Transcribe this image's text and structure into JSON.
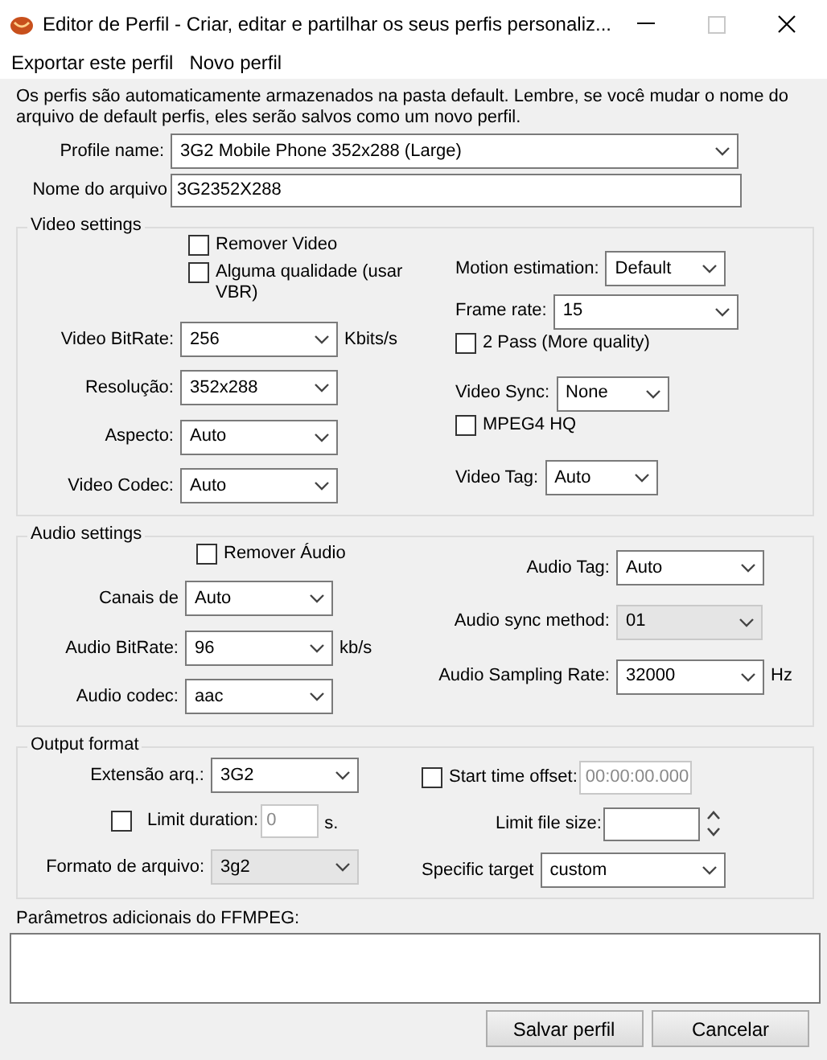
{
  "window": {
    "title": "Editor de Perfil - Criar, editar e partilhar os seus perfis personaliz..."
  },
  "menu": [
    "Exportar este perfil",
    "Novo perfil"
  ],
  "info": "Os perfis são automaticamente armazenados na pasta default. Lembre, se você mudar o nome do arquivo de default perfis, eles serão salvos como um novo perfil.",
  "profile_name": {
    "label": "Profile name:",
    "value": "3G2 Mobile Phone 352x288 (Large)"
  },
  "file_name": {
    "label": "Nome do arquivo",
    "value": "3G2352X288"
  },
  "sections": [
    {
      "title": "Video settings",
      "left": [
        {
          "kind": "checkbox",
          "label": "Remover Video",
          "checked": false
        },
        {
          "kind": "checkbox",
          "label": "Alguma qualidade (usar VBR)",
          "checked": false
        },
        {
          "kind": "select",
          "label": "Video BitRate:",
          "value": "256",
          "unit": "Kbits/s",
          "disabled": false
        },
        {
          "kind": "select",
          "label": "Resolução:",
          "value": "352x288",
          "disabled": false
        },
        {
          "kind": "select",
          "label": "Aspecto:",
          "value": "Auto",
          "disabled": false
        },
        {
          "kind": "select",
          "label": "Video Codec:",
          "value": "Auto",
          "disabled": false
        }
      ],
      "right": [
        {
          "kind": "select",
          "label": "Motion estimation:",
          "value": "Default",
          "disabled": false
        },
        {
          "kind": "select",
          "label": "Frame rate:",
          "value": "15",
          "disabled": false
        },
        {
          "kind": "checkbox",
          "label": "2 Pass (More quality)",
          "checked": false
        },
        {
          "kind": "select",
          "label": "Video Sync:",
          "value": "None",
          "disabled": false
        },
        {
          "kind": "checkbox",
          "label": "MPEG4 HQ",
          "checked": false
        },
        {
          "kind": "select",
          "label": "Video Tag:",
          "value": "Auto",
          "disabled": false
        }
      ]
    },
    {
      "title": "Audio settings",
      "left": [
        {
          "kind": "checkbox",
          "label": "Remover Áudio",
          "checked": false
        },
        {
          "kind": "select",
          "label": "Canais de",
          "value": "Auto",
          "disabled": false
        },
        {
          "kind": "select",
          "label": "Audio BitRate:",
          "value": "96",
          "unit": "kb/s",
          "disabled": false
        },
        {
          "kind": "select",
          "label": "Audio codec:",
          "value": "aac",
          "disabled": false
        }
      ],
      "right": [
        {
          "kind": "select",
          "label": "Audio Tag:",
          "value": "Auto",
          "disabled": false
        },
        {
          "kind": "select",
          "label": "Audio sync method:",
          "value": "01",
          "disabled": true
        },
        {
          "kind": "select",
          "label": "Audio Sampling Rate:",
          "value": "32000",
          "unit": "Hz",
          "disabled": false
        }
      ]
    },
    {
      "title": "Output format",
      "left": [
        {
          "kind": "select",
          "label": "Extensão arq.:",
          "value": "3G2",
          "disabled": false
        },
        {
          "kind": "check-field",
          "label": "Limit duration:",
          "value": "0",
          "unit": "s.",
          "checked": false
        },
        {
          "kind": "select",
          "label": "Formato de arquivo:",
          "value": "3g2",
          "disabled": true
        }
      ],
      "right": [
        {
          "kind": "check-field",
          "label": "Start time offset:",
          "value": "00:00:00.000",
          "checked": false
        },
        {
          "kind": "spin",
          "label": "Limit file size:"
        },
        {
          "kind": "select",
          "label": "Specific target",
          "value": "custom",
          "disabled": false
        }
      ]
    }
  ],
  "ffmpeg": {
    "label": "Parâmetros adicionais do FFMPEG:"
  },
  "buttons": [
    "Salvar perfil",
    "Cancelar"
  ]
}
